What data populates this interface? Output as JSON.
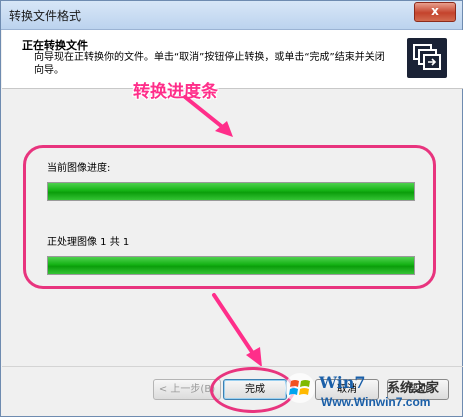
{
  "window": {
    "title": "转换文件格式",
    "close_label": "x"
  },
  "header": {
    "title": "正在转换文件",
    "description": "向导现在正转换你的文件。单击“取消”按钮停止转换，或单击“完成”结束并关闭向导。"
  },
  "annotation": {
    "text": "转换进度条"
  },
  "progress": {
    "current_label": "当前图像进度:",
    "current_value": 100,
    "processing_label": "正处理图像 1 共 1",
    "total_value": 100
  },
  "buttons": {
    "back": "< 上一步(B)",
    "finish": "完成",
    "cancel": "取消",
    "help": "帮助"
  },
  "colors": {
    "annotation": "#ff2e8a",
    "progress": "#14b214"
  },
  "watermark": {
    "brand": "Win7",
    "tag": "系统之家",
    "url": "Www.Winwin7.com"
  }
}
